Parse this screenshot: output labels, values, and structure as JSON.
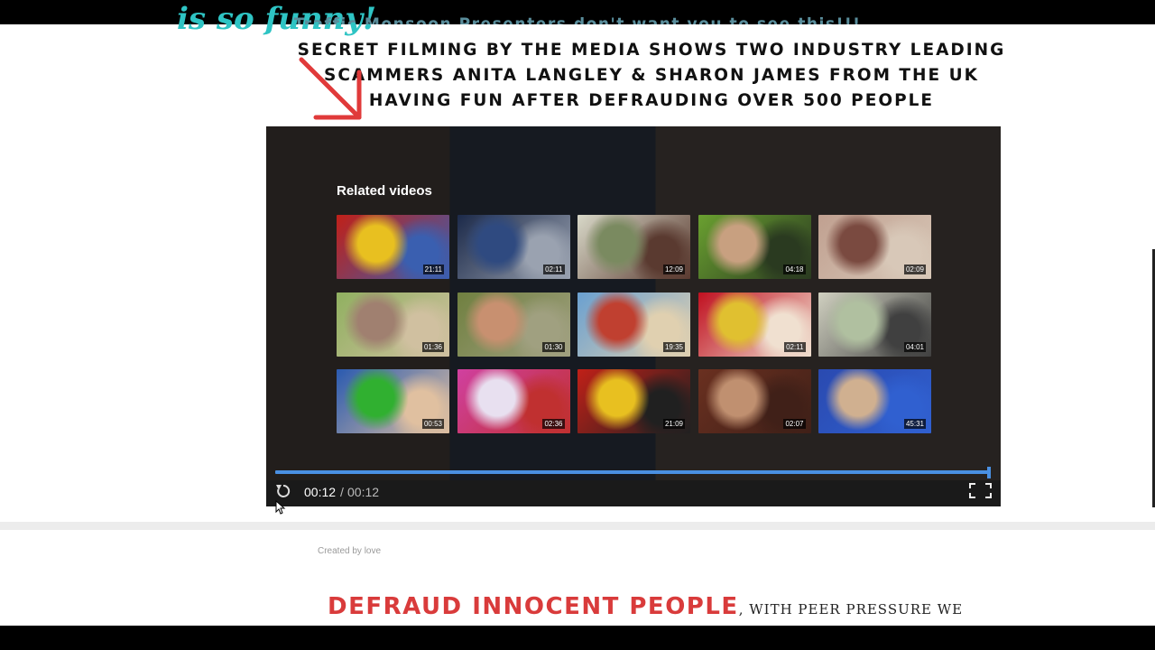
{
  "page": {
    "script_heading": "is so funny!",
    "teal_line": "Traffic Monsoon Presenters don't want you to see this!!!",
    "headline_lines": [
      "SECRET FILMING BY THE MEDIA SHOWS TWO INDUSTRY LEADING",
      "SCAMMERS ANITA LANGLEY & SHARON JAMES FROM THE UK",
      "HAVING FUN AFTER DEFRAUDING OVER 500 PEOPLE"
    ],
    "credit": "Created by love",
    "bottom_red": "DEFRAUD INNOCENT PEOPLE",
    "bottom_rest": ", WITH PEER PRESSURE WE"
  },
  "player": {
    "related_title": "Related videos",
    "progress_percent": 100,
    "time_current": "00:12",
    "time_separator": "/",
    "time_total": "00:12"
  },
  "related_videos": [
    {
      "duration": "21:11",
      "colors": [
        "#c02018",
        "#e8c020",
        "#3a5fb0"
      ]
    },
    {
      "duration": "02:11",
      "colors": [
        "#1c2a4a",
        "#2f4a80",
        "#9aa2b0"
      ]
    },
    {
      "duration": "12:09",
      "colors": [
        "#d8d8c8",
        "#7a8a60",
        "#5a3a30"
      ]
    },
    {
      "duration": "04:18",
      "colors": [
        "#6aa030",
        "#c8a080",
        "#2a3a20"
      ]
    },
    {
      "duration": "02:09",
      "colors": [
        "#c0a090",
        "#7a4a40",
        "#d8c8b8"
      ]
    },
    {
      "duration": "01:36",
      "colors": [
        "#90b060",
        "#a08070",
        "#d0c0a0"
      ]
    },
    {
      "duration": "01:30",
      "colors": [
        "#708040",
        "#c89070",
        "#a0a080"
      ]
    },
    {
      "duration": "19:35",
      "colors": [
        "#6aa0d0",
        "#c04030",
        "#e0d0b0"
      ]
    },
    {
      "duration": "02:11",
      "colors": [
        "#c01020",
        "#e0c030",
        "#f0e0d0"
      ]
    },
    {
      "duration": "04:01",
      "colors": [
        "#d0d0c0",
        "#b0c0a0",
        "#404040"
      ]
    },
    {
      "duration": "00:53",
      "colors": [
        "#2a5ab0",
        "#30b030",
        "#e0c0a0"
      ]
    },
    {
      "duration": "02:36",
      "colors": [
        "#d040a0",
        "#e8e0f0",
        "#c03030"
      ]
    },
    {
      "duration": "21:09",
      "colors": [
        "#c02018",
        "#e8c020",
        "#202020"
      ]
    },
    {
      "duration": "02:07",
      "colors": [
        "#6a3020",
        "#c09070",
        "#402018"
      ]
    },
    {
      "duration": "45:31",
      "colors": [
        "#2a4ab0",
        "#d0b090",
        "#3060d0"
      ]
    }
  ],
  "colors": {
    "accent_blue": "#4a90e2",
    "teal": "#2ec4c4",
    "red": "#d93b3b",
    "arrow_red": "#e03a3a"
  }
}
